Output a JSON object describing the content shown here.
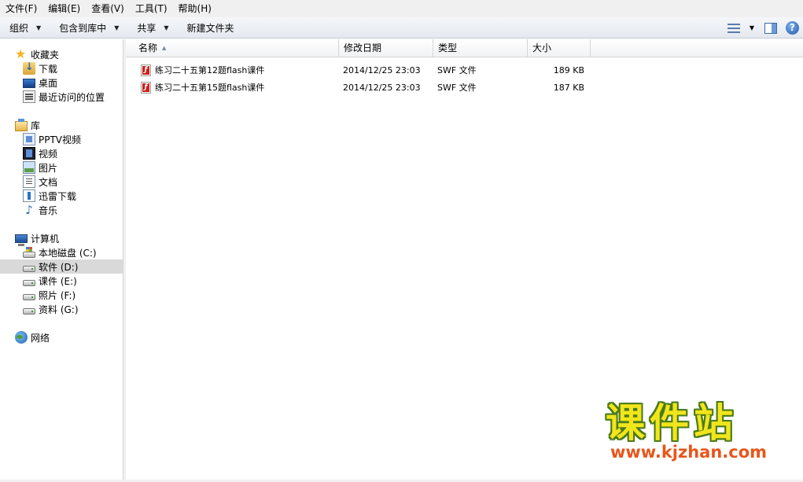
{
  "menu": [
    "文件(F)",
    "编辑(E)",
    "查看(V)",
    "工具(T)",
    "帮助(H)"
  ],
  "toolbar": {
    "organize": "组织",
    "include_library": "包含到库中",
    "share": "共享",
    "new_folder": "新建文件夹",
    "view_icon": "details-view-icon",
    "preview_pane_icon": "preview-pane-icon",
    "help_icon": "help-icon"
  },
  "nav": {
    "favorites": {
      "label": "收藏夹",
      "items": [
        "下载",
        "桌面",
        "最近访问的位置"
      ]
    },
    "libraries": {
      "label": "库",
      "items": [
        "PPTV视频",
        "视频",
        "图片",
        "文档",
        "迅雷下载",
        "音乐"
      ]
    },
    "computer": {
      "label": "计算机",
      "items": [
        "本地磁盘 (C:)",
        "软件 (D:)",
        "课件 (E:)",
        "照片 (F:)",
        "资料 (G:)"
      ],
      "selected": "软件 (D:)"
    },
    "network": {
      "label": "网络"
    }
  },
  "columns": {
    "name": "名称",
    "modified": "修改日期",
    "type": "类型",
    "size": "大小"
  },
  "files": [
    {
      "name": "练习二十五第12题flash课件",
      "modified": "2014/12/25 23:03",
      "type": "SWF 文件",
      "size": "189 KB"
    },
    {
      "name": "练习二十五第15题flash课件",
      "modified": "2014/12/25 23:03",
      "type": "SWF 文件",
      "size": "187 KB"
    }
  ],
  "watermark": {
    "title": "课件站",
    "url": "www.kjzhan.com"
  },
  "colors": {
    "selected_bg": "#d9d9d9",
    "watermark_yellow": "#f2e51c",
    "watermark_orange": "#e7561c",
    "swf_red": "#c9221e"
  }
}
